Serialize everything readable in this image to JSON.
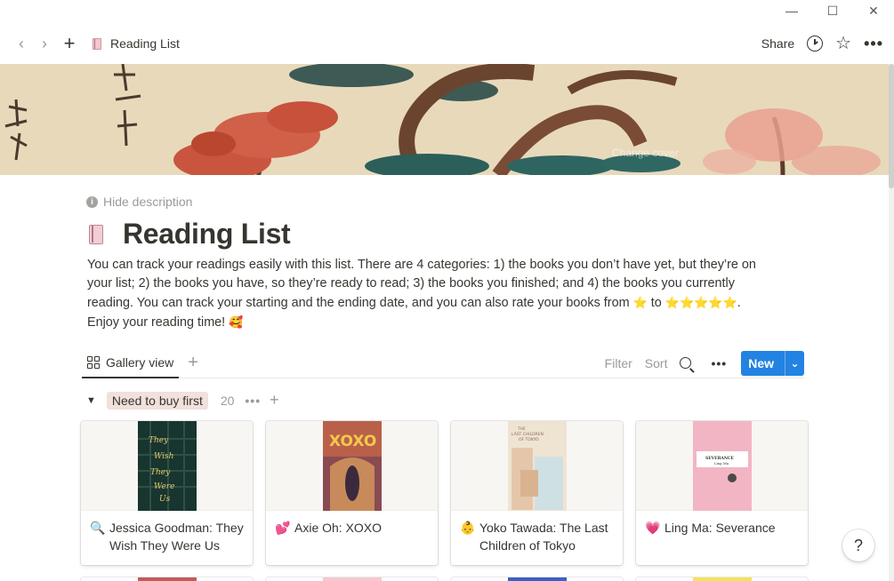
{
  "window": {
    "minimize": "—",
    "maximize": "☐",
    "close": "✕"
  },
  "topbar": {
    "back_icon": "‹",
    "forward_icon": "›",
    "new_icon": "+",
    "breadcrumb": "Reading List",
    "share": "Share",
    "star": "☆",
    "more": "•••"
  },
  "cover": {
    "change_label": "Change cover"
  },
  "page": {
    "hide_description": "Hide description",
    "title": "Reading List",
    "description_part1": "You can track your readings easily with this list. There are 4 categories: 1) the books you don’t have yet, but they’re on your list; 2) the books you have, so they’re ready to read; 3) the books you finished; and 4) the books you currently reading. You can track your starting and the ending date, and you can also rate your books from ",
    "star_one": "⭐",
    "description_to": " to ",
    "stars_five": "⭐⭐⭐⭐⭐",
    "description_part2": ". Enjoy your reading time! ",
    "end_emoji": "🥰"
  },
  "viewbar": {
    "tab_label": "Gallery view",
    "add": "+",
    "filter": "Filter",
    "sort": "Sort",
    "more": "•••",
    "new_label": "New",
    "new_dropdown": "⌄"
  },
  "group": {
    "caret": "▼",
    "name": "Need to buy first",
    "count": "20",
    "more": "•••",
    "add": "+"
  },
  "cards": [
    {
      "emoji": "🔍",
      "title": "Jessica Goodman: They Wish They Were Us",
      "cover_color": "#1d3a32"
    },
    {
      "emoji": "💕",
      "title": "Axie Oh: XOXO",
      "cover_color": "#c66b4b"
    },
    {
      "emoji": "👶",
      "title": "Yoko Tawada: The Last Children of Tokyo",
      "cover_color": "#eadfcf"
    },
    {
      "emoji": "💗",
      "title": "Ling Ma: Severance",
      "cover_color": "#f2b8c6"
    }
  ],
  "help": "?"
}
